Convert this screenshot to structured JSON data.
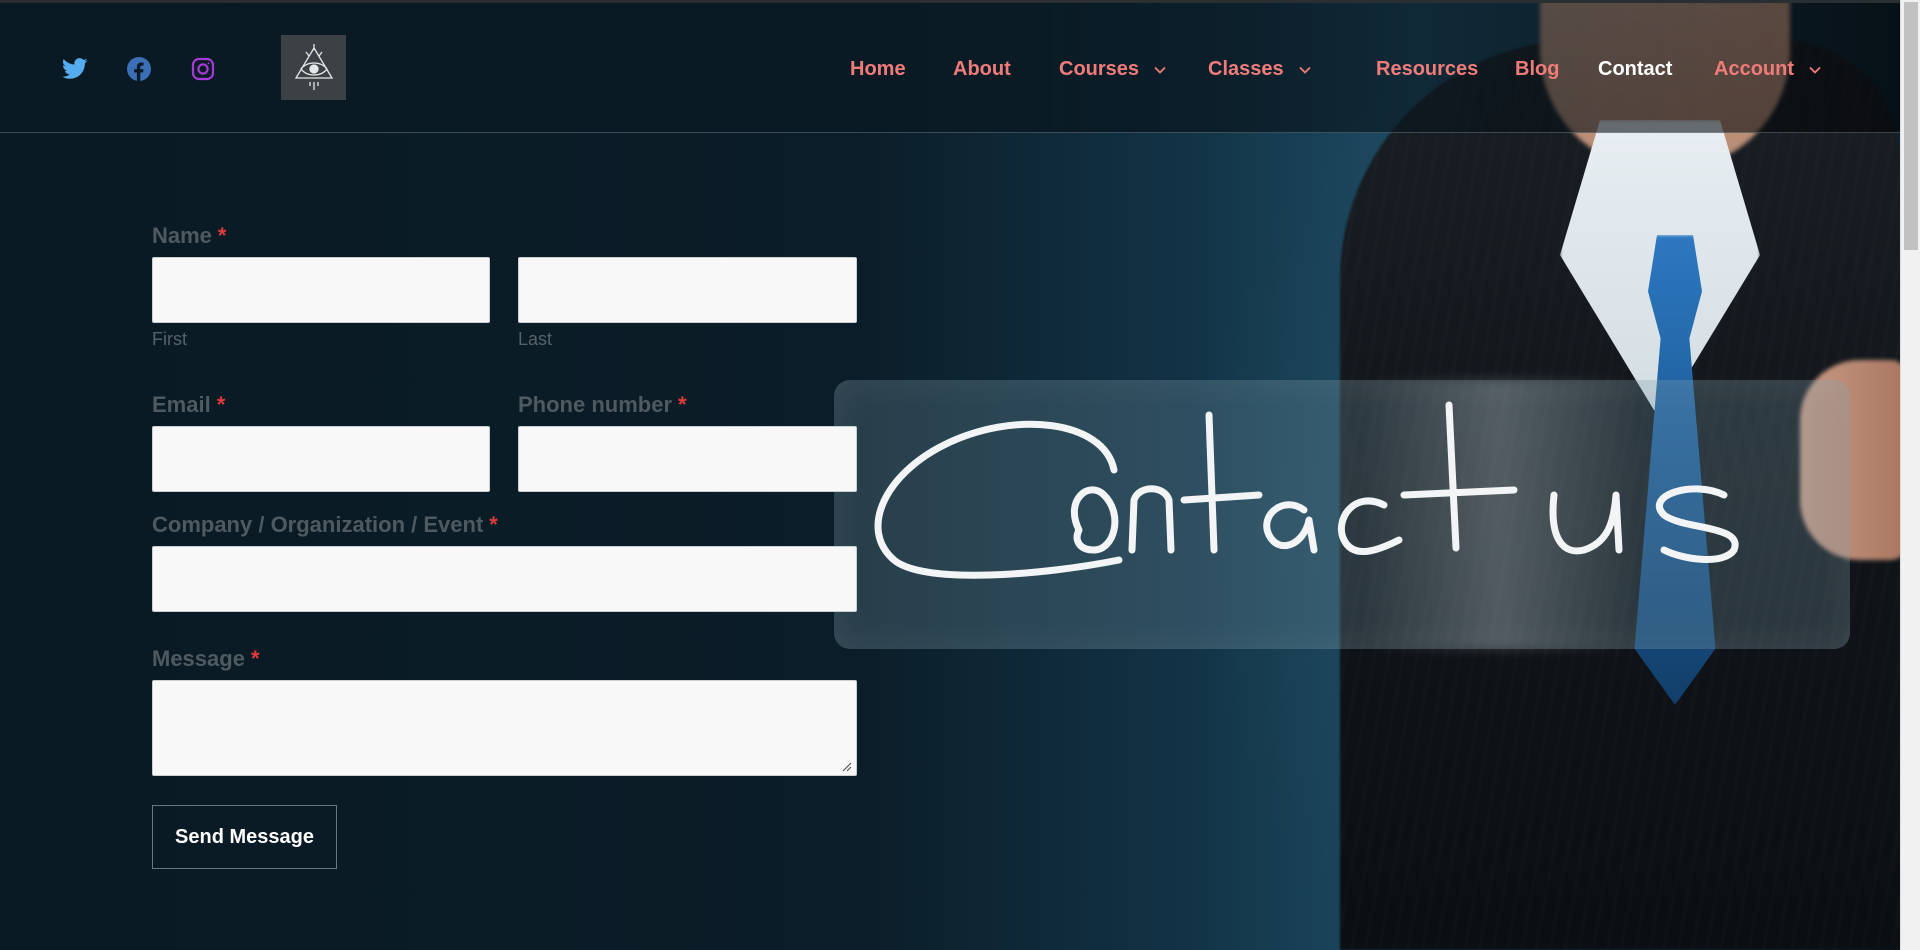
{
  "social": {
    "twitter": {
      "icon": "twitter-icon",
      "color": "#55acee"
    },
    "facebook": {
      "icon": "facebook-icon",
      "color": "#3b6fb6"
    },
    "instagram": {
      "icon": "instagram-icon",
      "color": "#a53bd6"
    }
  },
  "logo": {
    "icon": "all-seeing-eye-logo-icon"
  },
  "nav": {
    "items": [
      {
        "label": "Home"
      },
      {
        "label": "About"
      },
      {
        "label": "Courses",
        "dropdown": true
      },
      {
        "label": "Classes",
        "dropdown": true
      },
      {
        "label": "Resources"
      },
      {
        "label": "Blog"
      },
      {
        "label": "Contact",
        "active": true
      },
      {
        "label": "Account",
        "dropdown": true
      }
    ],
    "link_color": "#f07c7a",
    "active_color": "#ffffff"
  },
  "form": {
    "name_label": "Name",
    "first_sublabel": "First",
    "last_sublabel": "Last",
    "email_label": "Email",
    "phone_label": "Phone number",
    "company_label": "Company / Organization / Event",
    "message_label": "Message",
    "required_marker": "*",
    "required_color": "#e33b3b",
    "first_value": "",
    "last_value": "",
    "email_value": "",
    "phone_value": "",
    "company_value": "",
    "message_value": "",
    "submit_label": "Send Message"
  }
}
